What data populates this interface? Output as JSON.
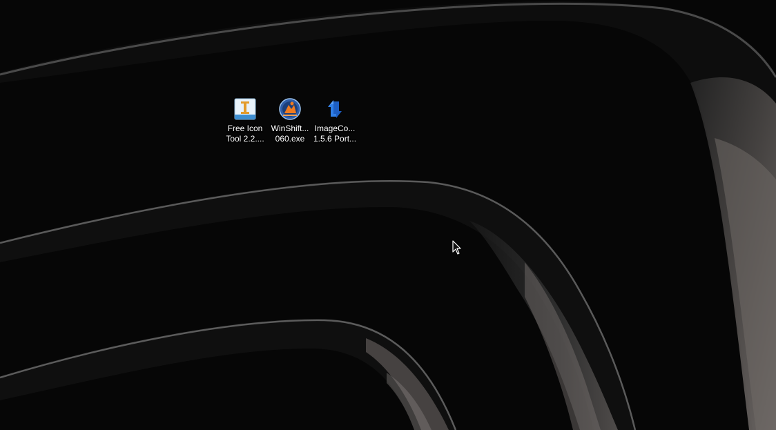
{
  "desktop": {
    "icons": [
      {
        "line1": "Free Icon",
        "line2": "Tool 2.2....",
        "icon": "free-icon-tool-icon"
      },
      {
        "line1": "WinShift...",
        "line2": "060.exe",
        "icon": "winshift-icon"
      },
      {
        "line1": "ImageCo...",
        "line2": "1.5.6 Port...",
        "icon": "imageconverter-icon"
      }
    ]
  },
  "colors": {
    "background": "#060606",
    "label_text": "#ffffff"
  }
}
